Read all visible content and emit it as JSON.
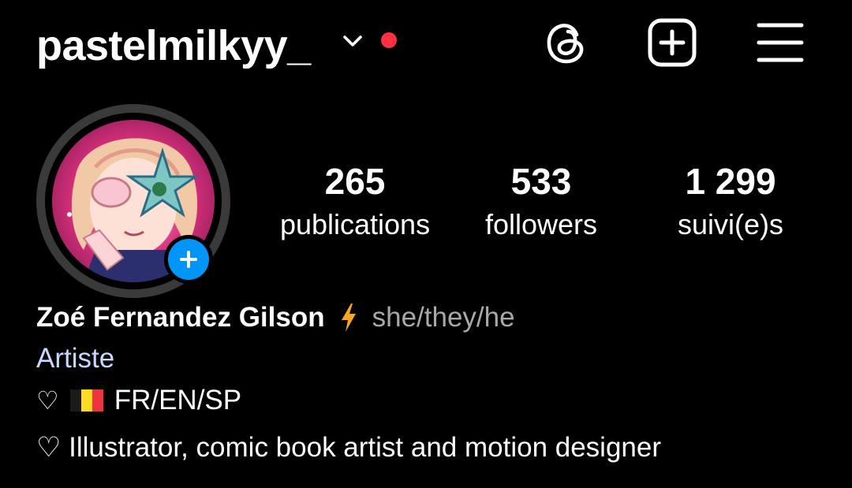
{
  "header": {
    "username": "pastelmilkyy_",
    "icons": {
      "chevron": "chevron-down-icon",
      "threads": "threads-icon",
      "create": "add-square-icon",
      "menu": "hamburger-menu-icon"
    }
  },
  "stats": {
    "posts": {
      "value": "265",
      "label": "publications"
    },
    "followers": {
      "value": "533",
      "label": "followers"
    },
    "following": {
      "value": "1 299",
      "label": "suivi(e)s"
    }
  },
  "bio": {
    "full_name": "Zoé Fernandez Gilson",
    "name_emoji": "lightning-bolt-icon",
    "pronouns": "she/they/he",
    "category": "Artiste",
    "line1_heart": "♡",
    "line1_flag": "belgium-flag-icon",
    "line1_text": "FR/EN/SP",
    "line2_text": "♡ Illustrator, comic book artist and motion designer"
  },
  "colors": {
    "background": "#000000",
    "text": "#ffffff",
    "secondary_text": "#a8a8a8",
    "category": "#c7d7ff",
    "notification_dot": "#ff3040",
    "add_badge": "#0095f6",
    "bolt": "#f5a623",
    "avatar_ring": "#3a3a3a"
  }
}
